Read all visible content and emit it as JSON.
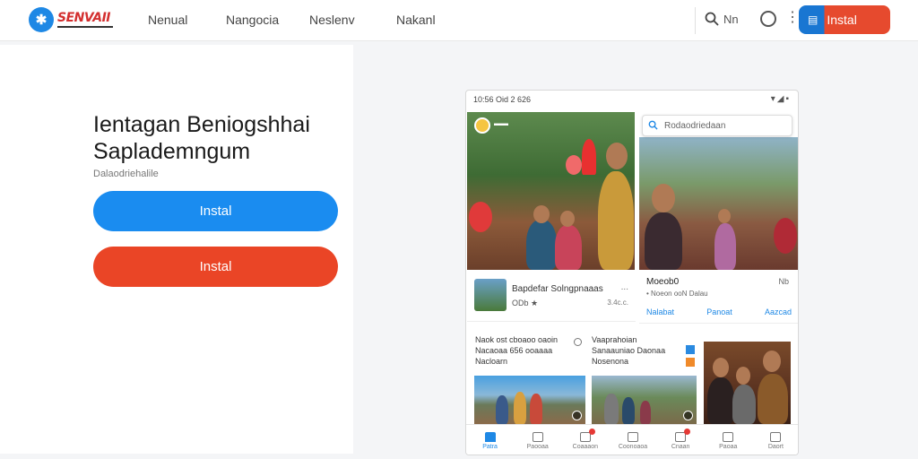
{
  "brand": {
    "logo_text": "SENVAII"
  },
  "nav": {
    "items": [
      "Nenual",
      "Nangocia",
      "Neslenv",
      "Nakanl"
    ]
  },
  "header": {
    "search_label": "Nn",
    "install_label": "Instal"
  },
  "hero": {
    "title": "Ientagan Beniogshhai Saplademngum",
    "subtitle": "Dalaodriehalile",
    "primary_button": "Instal",
    "secondary_button": "Instal"
  },
  "phone": {
    "status_time": "10:56 Oid 2 626",
    "search_placeholder": "Rodaodriedaan",
    "card": {
      "title": "Bapdefar Solngpnaaas",
      "meta": "ODb ★",
      "side": "3.4c.c.",
      "dots": "..."
    },
    "info": {
      "title": "Moeob0",
      "right": "Nb",
      "sub": "• Noeon ooN Dalau",
      "actions": [
        "Nalabat",
        "Panoat",
        "Aazcad"
      ]
    },
    "news_left": [
      "Naok ost cboaoo oaoin",
      "Nacaoaa 656 ooaaaa",
      "Nacloarn"
    ],
    "news_right": [
      "Vaaprahoian",
      "Sanaauniao Daonaa",
      "Nosenona"
    ],
    "tabs": [
      "Patra",
      "Paooaa",
      "Coaaaon",
      "Coonoaoa",
      "Cnaan",
      "Paoaa",
      "Daort"
    ],
    "active_tab": 0,
    "colors": {
      "accent": "#1e88e5",
      "alert": "#e53935"
    }
  }
}
